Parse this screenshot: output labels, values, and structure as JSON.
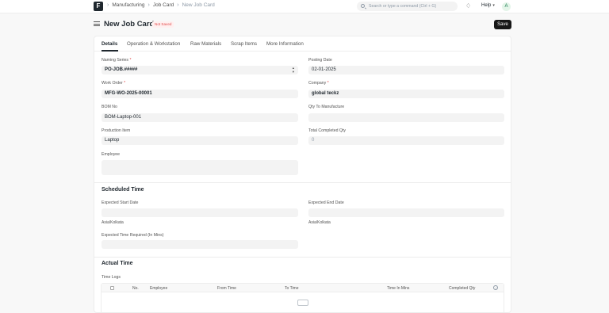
{
  "navbar": {
    "logo_letter": "F",
    "breadcrumbs": [
      "Manufacturing",
      "Job Card",
      "New Job Card"
    ],
    "search_placeholder": "Search or type a command (Ctrl + G)",
    "help_label": "Help",
    "avatar_initial": "A"
  },
  "page": {
    "title": "New Job Card",
    "status_badge": "Not Saved",
    "save_label": "Save"
  },
  "tabs": [
    "Details",
    "Operation & Workstation",
    "Raw Materials",
    "Scrap Items",
    "More Information"
  ],
  "details": {
    "naming_series": {
      "label": "Naming Series",
      "value": "PO-JOB.#####"
    },
    "posting_date": {
      "label": "Posting Date",
      "value": "02-01-2025"
    },
    "work_order": {
      "label": "Work Order",
      "value": "MFG-WO-2025-00001"
    },
    "company": {
      "label": "Company",
      "value": "global teckz"
    },
    "bom_no": {
      "label": "BOM No",
      "value": "BOM-Laptop-001"
    },
    "qty_to_manufacture": {
      "label": "Qty To Manufacture",
      "value": ""
    },
    "production_item": {
      "label": "Production Item",
      "value": "Laptop"
    },
    "total_completed_qty": {
      "label": "Total Completed Qty",
      "value": "0"
    },
    "employee": {
      "label": "Employee",
      "value": ""
    }
  },
  "scheduled_time": {
    "heading": "Scheduled Time",
    "expected_start_date": {
      "label": "Expected Start Date",
      "value": "",
      "timezone": "Asia/Kolkata"
    },
    "expected_end_date": {
      "label": "Expected End Date",
      "value": "",
      "timezone": "Asia/Kolkata"
    },
    "expected_time_required": {
      "label": "Expected Time Required (In Mins)",
      "value": ""
    }
  },
  "actual_time": {
    "heading": "Actual Time",
    "time_logs_label": "Time Logs",
    "columns": [
      "No.",
      "Employee",
      "From Time",
      "To Time",
      "Time In Mins",
      "Completed Qty"
    ]
  },
  "colors": {
    "primary_button": "#171717",
    "not_saved_text": "#e24c4c",
    "field_background": "#f3f3f3"
  }
}
